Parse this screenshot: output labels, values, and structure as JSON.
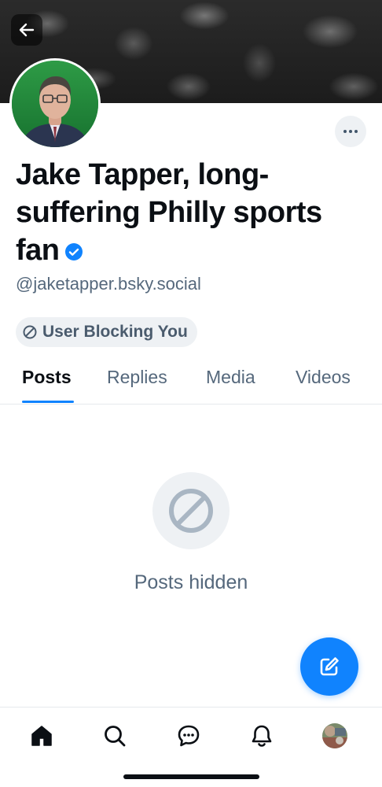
{
  "profile": {
    "display_name": "Jake Tapper, long-suffering Philly sports fan",
    "handle": "@jaketapper.bsky.social",
    "verified": true,
    "blocking_label": "User Blocking You"
  },
  "tabs": [
    {
      "label": "Posts",
      "active": true
    },
    {
      "label": "Replies",
      "active": false
    },
    {
      "label": "Media",
      "active": false
    },
    {
      "label": "Videos",
      "active": false
    }
  ],
  "empty_state": {
    "icon": "blocked-icon",
    "text": "Posts hidden"
  },
  "bottom_nav": [
    {
      "name": "home",
      "icon": "home-icon",
      "active": true
    },
    {
      "name": "search",
      "icon": "search-icon",
      "active": false
    },
    {
      "name": "chat",
      "icon": "chat-icon",
      "active": false
    },
    {
      "name": "notifications",
      "icon": "bell-icon",
      "active": false
    },
    {
      "name": "profile",
      "icon": "avatar",
      "active": false
    }
  ],
  "colors": {
    "accent": "#1083fe",
    "text_primary": "#0b0f14",
    "text_secondary": "#55687c",
    "pill_bg": "#eef1f4",
    "divider": "#e6e9ed"
  },
  "icons": {
    "back": "arrow-left-icon",
    "more": "ellipsis-icon",
    "verified": "verified-check-icon",
    "blocked": "blocked-icon",
    "compose": "compose-icon"
  }
}
